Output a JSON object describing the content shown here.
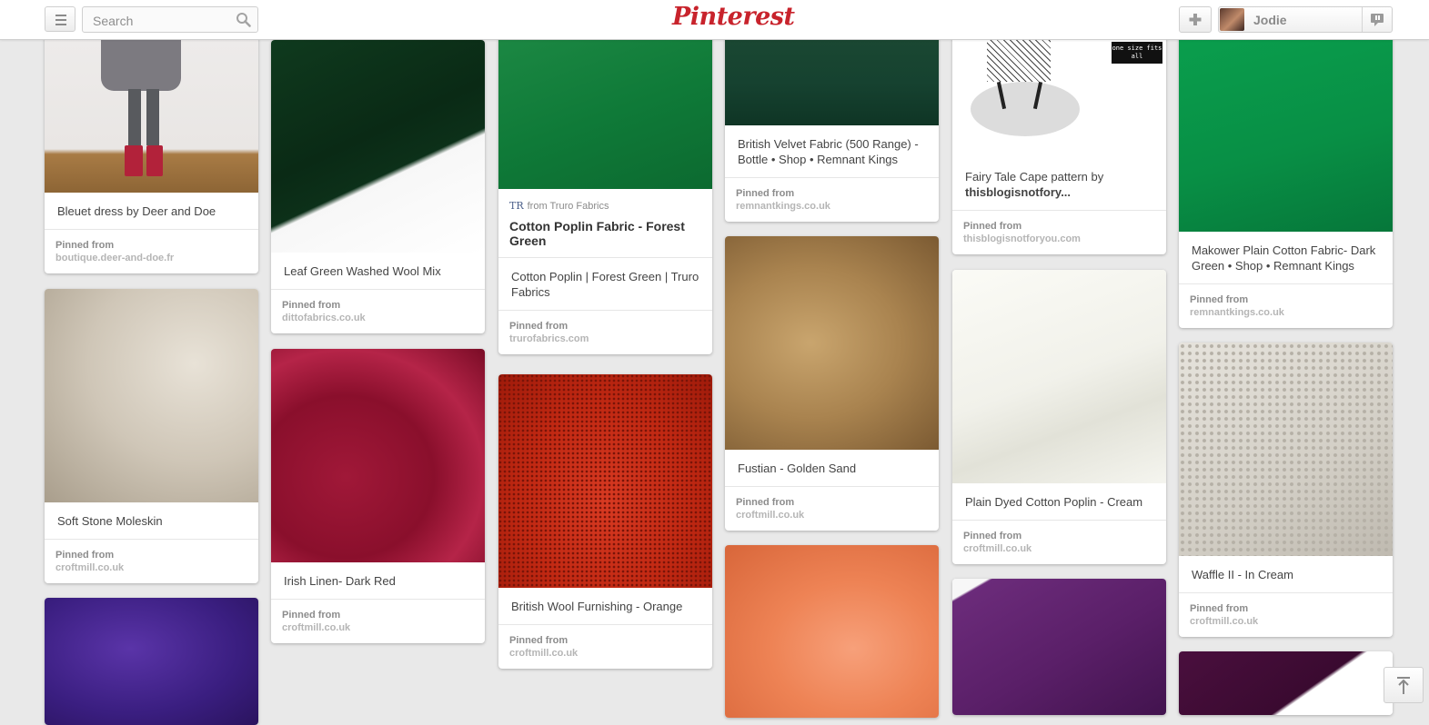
{
  "header": {
    "search_placeholder": "Search",
    "logo": "Pinterest",
    "user_name": "Jodie"
  },
  "colors": {
    "brand": "#c8232c"
  },
  "icons": {
    "menu": "menu-icon",
    "search": "search-icon",
    "add": "plus-icon",
    "notifications": "notification-icon",
    "scroll_top": "scroll-top-icon"
  },
  "pins": {
    "c1": [
      {
        "desc": "Bleuet dress by Deer and Doe",
        "label": "Pinned from",
        "domain": "boutique.deer-and-doe.fr"
      },
      {
        "desc": "Soft Stone Moleskin",
        "label": "Pinned from",
        "domain": "croftmill.co.uk"
      }
    ],
    "c2": [
      {
        "desc": "Leaf Green Washed Wool Mix",
        "label": "Pinned from",
        "domain": "dittofabrics.co.uk"
      },
      {
        "desc": "Irish Linen- Dark Red",
        "label": "Pinned from",
        "domain": "croftmill.co.uk"
      }
    ],
    "c3": [
      {
        "source_prefix": "from Truro Fabrics",
        "title": "Cotton Poplin Fabric - Forest Green",
        "desc": "Cotton Poplin | Forest Green | Truro Fabrics",
        "label": "Pinned from",
        "domain": "trurofabrics.com"
      },
      {
        "desc": "British Wool Furnishing - Orange",
        "label": "Pinned from",
        "domain": "croftmill.co.uk"
      }
    ],
    "c4": [
      {
        "desc": "British Velvet Fabric (500 Range) - Bottle • Shop • Remnant Kings",
        "label": "Pinned from",
        "domain": "remnantkings.co.uk"
      },
      {
        "desc": "Fustian - Golden Sand",
        "label": "Pinned from",
        "domain": "croftmill.co.uk"
      }
    ],
    "c5": [
      {
        "desc": "Fairy Tale Cape pattern by",
        "desc_strong": "thisblogisnotfory...",
        "label": "Pinned from",
        "domain": "thisblogisnotforyou.com",
        "img_tag": "one size fits all"
      },
      {
        "desc": "Plain Dyed Cotton Poplin - Cream",
        "label": "Pinned from",
        "domain": "croftmill.co.uk"
      }
    ],
    "c6": [
      {
        "desc": "Makower Plain Cotton Fabric- Dark Green • Shop • Remnant Kings",
        "label": "Pinned from",
        "domain": "remnantkings.co.uk"
      },
      {
        "desc": "Waffle II - In Cream",
        "label": "Pinned from",
        "domain": "croftmill.co.uk"
      }
    ]
  }
}
